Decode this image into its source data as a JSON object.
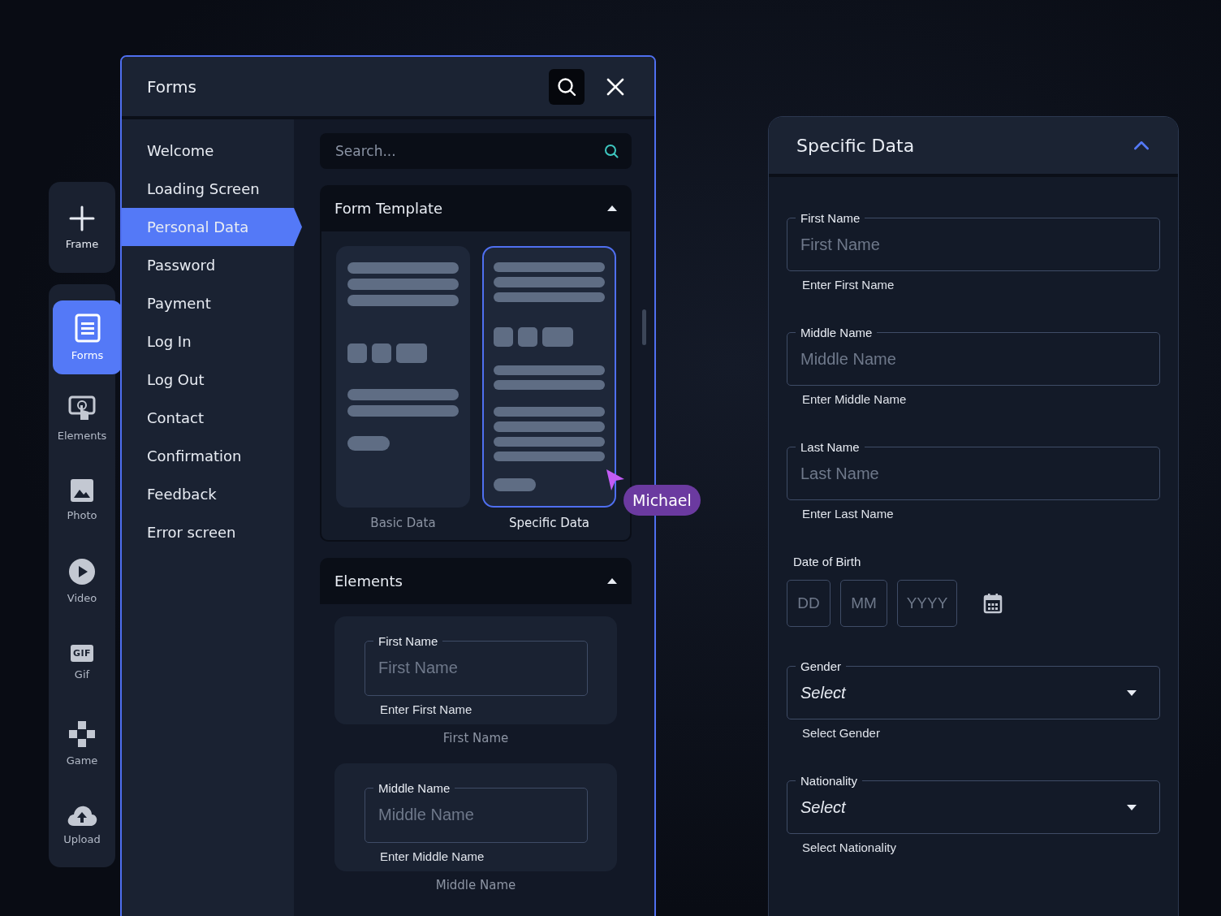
{
  "toolbar": {
    "add": {
      "label": "Frame"
    },
    "items": [
      {
        "kind": "forms",
        "label": "Forms",
        "selected": true
      },
      {
        "kind": "elements",
        "label": "Elements",
        "selected": false
      },
      {
        "kind": "photo",
        "label": "Photo",
        "selected": false
      },
      {
        "kind": "video",
        "label": "Video",
        "selected": false
      },
      {
        "kind": "gif",
        "label": "Gif",
        "icon_text": "GIF",
        "selected": false
      },
      {
        "kind": "game",
        "label": "Game",
        "selected": false
      },
      {
        "kind": "upload",
        "label": "Upload",
        "selected": false
      }
    ]
  },
  "forms_window": {
    "title": "Forms",
    "menu": [
      {
        "label": "Welcome",
        "selected": false
      },
      {
        "label": "Loading Screen",
        "selected": false
      },
      {
        "label": "Personal Data",
        "selected": true
      },
      {
        "label": "Password",
        "selected": false
      },
      {
        "label": "Payment",
        "selected": false
      },
      {
        "label": "Log In",
        "selected": false
      },
      {
        "label": "Log Out",
        "selected": false
      },
      {
        "label": "Contact",
        "selected": false
      },
      {
        "label": "Confirmation",
        "selected": false
      },
      {
        "label": "Feedback",
        "selected": false
      },
      {
        "label": "Error screen",
        "selected": false
      }
    ],
    "search": {
      "placeholder": "Search..."
    },
    "template_section": {
      "title": "Form Template",
      "expanded": true,
      "templates": [
        {
          "kind": "basic",
          "label": "Basic Data",
          "selected": false
        },
        {
          "kind": "specific",
          "label": "Specific Data",
          "selected": true
        }
      ]
    },
    "elements_section": {
      "title": "Elements",
      "expanded": true,
      "elements": [
        {
          "label": "First Name",
          "placeholder": "First Name",
          "helper": "Enter First Name",
          "caption": "First Name"
        },
        {
          "label": "Middle Name",
          "placeholder": "Middle Name",
          "helper": "Enter Middle Name",
          "caption": "Middle Name"
        }
      ]
    },
    "cursor": {
      "name": "Michael"
    }
  },
  "specific_panel": {
    "title": "Specific Data",
    "expanded": true,
    "fields": [
      {
        "kind": "text",
        "label": "First Name",
        "placeholder": "First Name",
        "helper": "Enter First Name"
      },
      {
        "kind": "text",
        "label": "Middle Name",
        "placeholder": "Middle Name",
        "helper": "Enter Middle Name"
      },
      {
        "kind": "text",
        "label": "Last Name",
        "placeholder": "Last Name",
        "helper": "Enter Last Name"
      },
      {
        "kind": "date",
        "label": "Date of Birth",
        "placeholders": [
          "DD",
          "MM",
          "YYYY"
        ]
      },
      {
        "kind": "select",
        "label": "Gender",
        "value": "Select",
        "helper": "Select Gender"
      },
      {
        "kind": "select",
        "label": "Nationality",
        "value": "Select",
        "helper": "Select Nationality"
      }
    ]
  }
}
